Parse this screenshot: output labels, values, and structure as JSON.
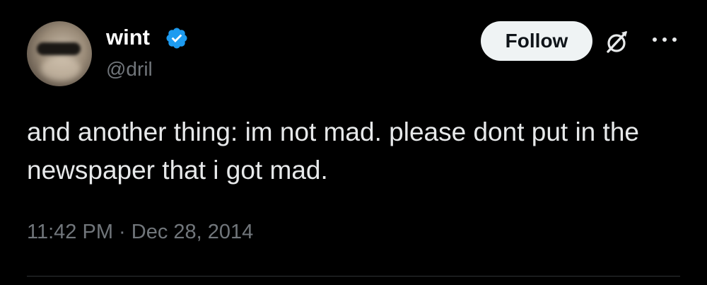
{
  "author": {
    "display_name": "wint",
    "handle": "@dril",
    "verified": true
  },
  "actions": {
    "follow_label": "Follow",
    "grok_icon": "grok-icon",
    "more_icon": "more-options-icon"
  },
  "tweet": {
    "text": "and another thing: im not mad. please dont put in the newspaper that i got mad.",
    "time": "11:42 PM",
    "separator": "·",
    "date": "Dec 28, 2014"
  },
  "colors": {
    "background": "#000000",
    "text_primary": "#e7e9ea",
    "text_secondary": "#71767b",
    "verified_blue": "#1d9bf0",
    "follow_button_bg": "#eff3f4",
    "divider": "#2f3336"
  }
}
